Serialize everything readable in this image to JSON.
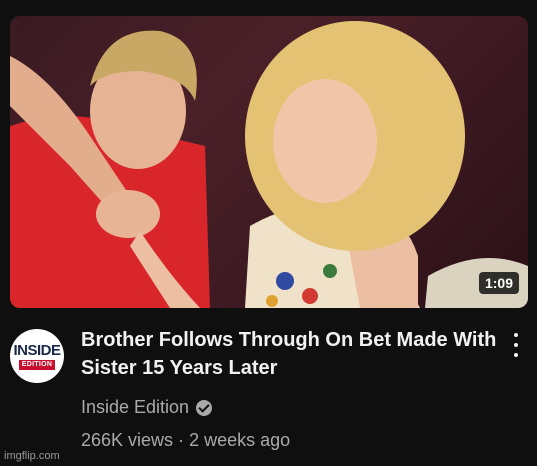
{
  "video": {
    "title": "Brother Follows Through On Bet Made With Sister 15 Years Later",
    "duration": "1:09",
    "channel": "Inside Edition",
    "views": "266K views",
    "age": "2 weeks ago",
    "separator": "·"
  },
  "avatar": {
    "line1": "INSIDE",
    "line2": "EDITION"
  },
  "icons": {
    "verified": "verified-check-icon",
    "menu": "more-vertical-icon"
  },
  "watermark": "imgflip.com"
}
